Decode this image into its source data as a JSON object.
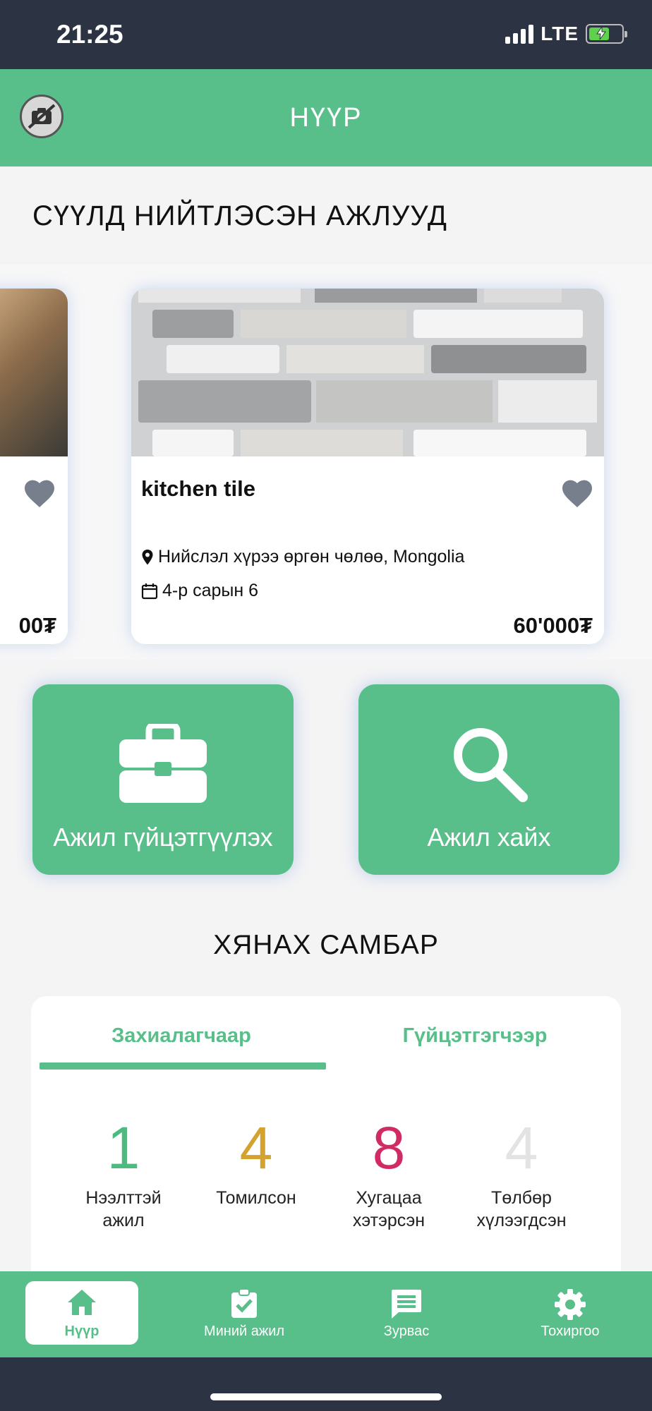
{
  "status_bar": {
    "time": "21:25",
    "network": "LTE"
  },
  "app_bar": {
    "title": "НҮҮР"
  },
  "recent_jobs": {
    "section_title": "СҮҮЛД НИЙТЛЭСЭН АЖЛУУД",
    "partial_card": {
      "price": "00₮"
    },
    "cards": [
      {
        "title": "kitchen tile",
        "location": "Нийслэл хүрээ өргөн чөлөө, Mongolia",
        "date": "4-р сарын 6",
        "price": "60'000₮"
      }
    ]
  },
  "actions": {
    "do_job_label": "Ажил гүйцэтгүүлэх",
    "find_job_label": "Ажил хайх"
  },
  "dashboard": {
    "title": "ХЯНАХ САМБАР",
    "tabs": [
      {
        "label": "Захиалагчаар",
        "active": true
      },
      {
        "label": "Гүйцэтгэгчээр",
        "active": false
      }
    ],
    "stats": [
      {
        "value": "1",
        "label_line1": "Нээлттэй",
        "label_line2": "ажил",
        "color": "#4dbb7f"
      },
      {
        "value": "4",
        "label_line1": "Томилсон",
        "label_line2": "",
        "color": "#d4a22e"
      },
      {
        "value": "8",
        "label_line1": "Хугацаа",
        "label_line2": "хэтэрсэн",
        "color": "#d12b66"
      },
      {
        "value": "4",
        "label_line1": "Төлбөр",
        "label_line2": "хүлээгдсэн",
        "color": "#e3e3e3"
      }
    ]
  },
  "bottom_nav": {
    "items": [
      {
        "label": "Нүүр",
        "icon": "home-icon",
        "active": true
      },
      {
        "label": "Миний ажил",
        "icon": "clipboard-check-icon",
        "active": false
      },
      {
        "label": "Зурвас",
        "icon": "message-icon",
        "active": false
      },
      {
        "label": "Тохиргоо",
        "icon": "gear-icon",
        "active": false
      }
    ]
  },
  "colors": {
    "primary": "#59bf8a",
    "dark": "#2c3342"
  }
}
